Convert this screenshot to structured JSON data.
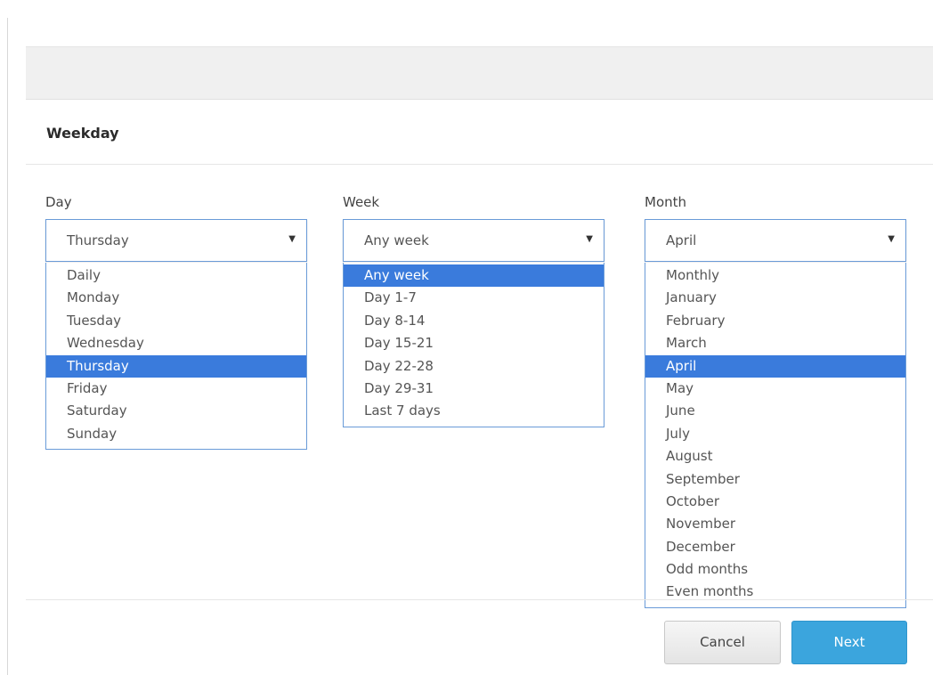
{
  "section": {
    "title": "Weekday"
  },
  "fields": {
    "day": {
      "label": "Day",
      "value": "Thursday",
      "options": [
        "Daily",
        "Monday",
        "Tuesday",
        "Wednesday",
        "Thursday",
        "Friday",
        "Saturday",
        "Sunday"
      ],
      "selected_index": 4
    },
    "week": {
      "label": "Week",
      "value": "Any week",
      "options": [
        "Any week",
        "Day 1-7",
        "Day 8-14",
        "Day 15-21",
        "Day 22-28",
        "Day 29-31",
        "Last 7 days"
      ],
      "selected_index": 0
    },
    "month": {
      "label": "Month",
      "value": "April",
      "options": [
        "Monthly",
        "January",
        "February",
        "March",
        "April",
        "May",
        "June",
        "July",
        "August",
        "September",
        "October",
        "November",
        "December",
        "Odd months",
        "Even months"
      ],
      "selected_index": 4
    }
  },
  "icons": {
    "dropdown_arrow": "▼"
  },
  "buttons": {
    "cancel_label": "Cancel",
    "next_label": "Next"
  },
  "colors": {
    "accent": "#3ba5dd",
    "selected_option": "#3a7bdc",
    "focus_border": "#6a9bd8"
  }
}
